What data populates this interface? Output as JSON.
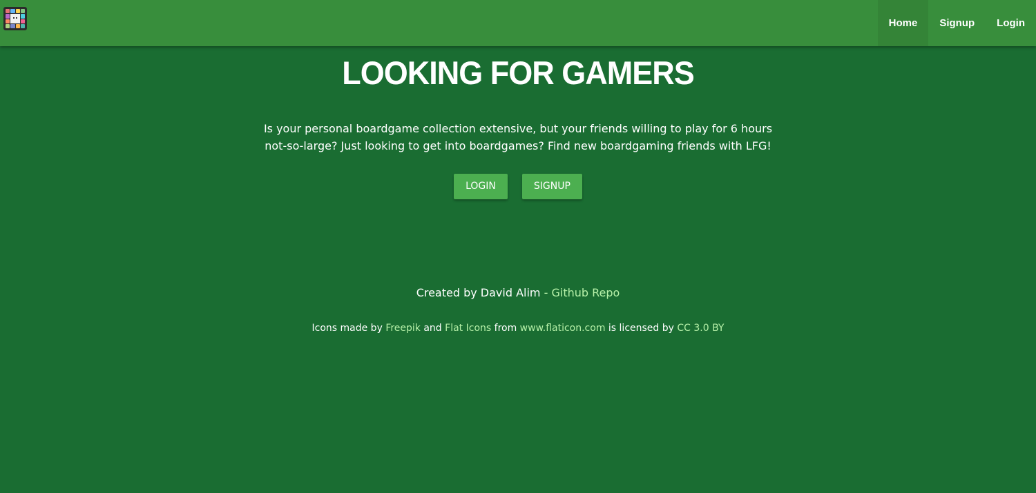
{
  "navbar": {
    "logo_icon": "board-grid-logo-icon",
    "links": [
      {
        "label": "Home"
      },
      {
        "label": "Signup"
      },
      {
        "label": "Login"
      }
    ]
  },
  "hero": {
    "title": "LOOKING FOR GAMERS",
    "intro": "Is your personal boardgame collection extensive, but your friends willing to play for 6 hours not-so-large? Just looking to get into boardgames? Find new boardgaming friends with LFG!",
    "login_button": "LOGIN",
    "signup_button": "SIGNUP"
  },
  "footer": {
    "created_prefix": "Created by David Alim",
    "created_sep": " - ",
    "repo_link": "Github Repo",
    "credits_prefix": "Icons made by ",
    "freepik_link": "Freepik",
    "and_text": " and ",
    "flaticons_link": "Flat Icons",
    "from_text": " from ",
    "flaticon_site_link": "www.flaticon.com",
    "licensed_text": " is licensed by ",
    "license_link": "CC 3.0 BY"
  },
  "colors": {
    "background": "#1a6d32",
    "navbar": "#388e3c",
    "button": "#4caf50",
    "link": "#b6f0a8"
  }
}
